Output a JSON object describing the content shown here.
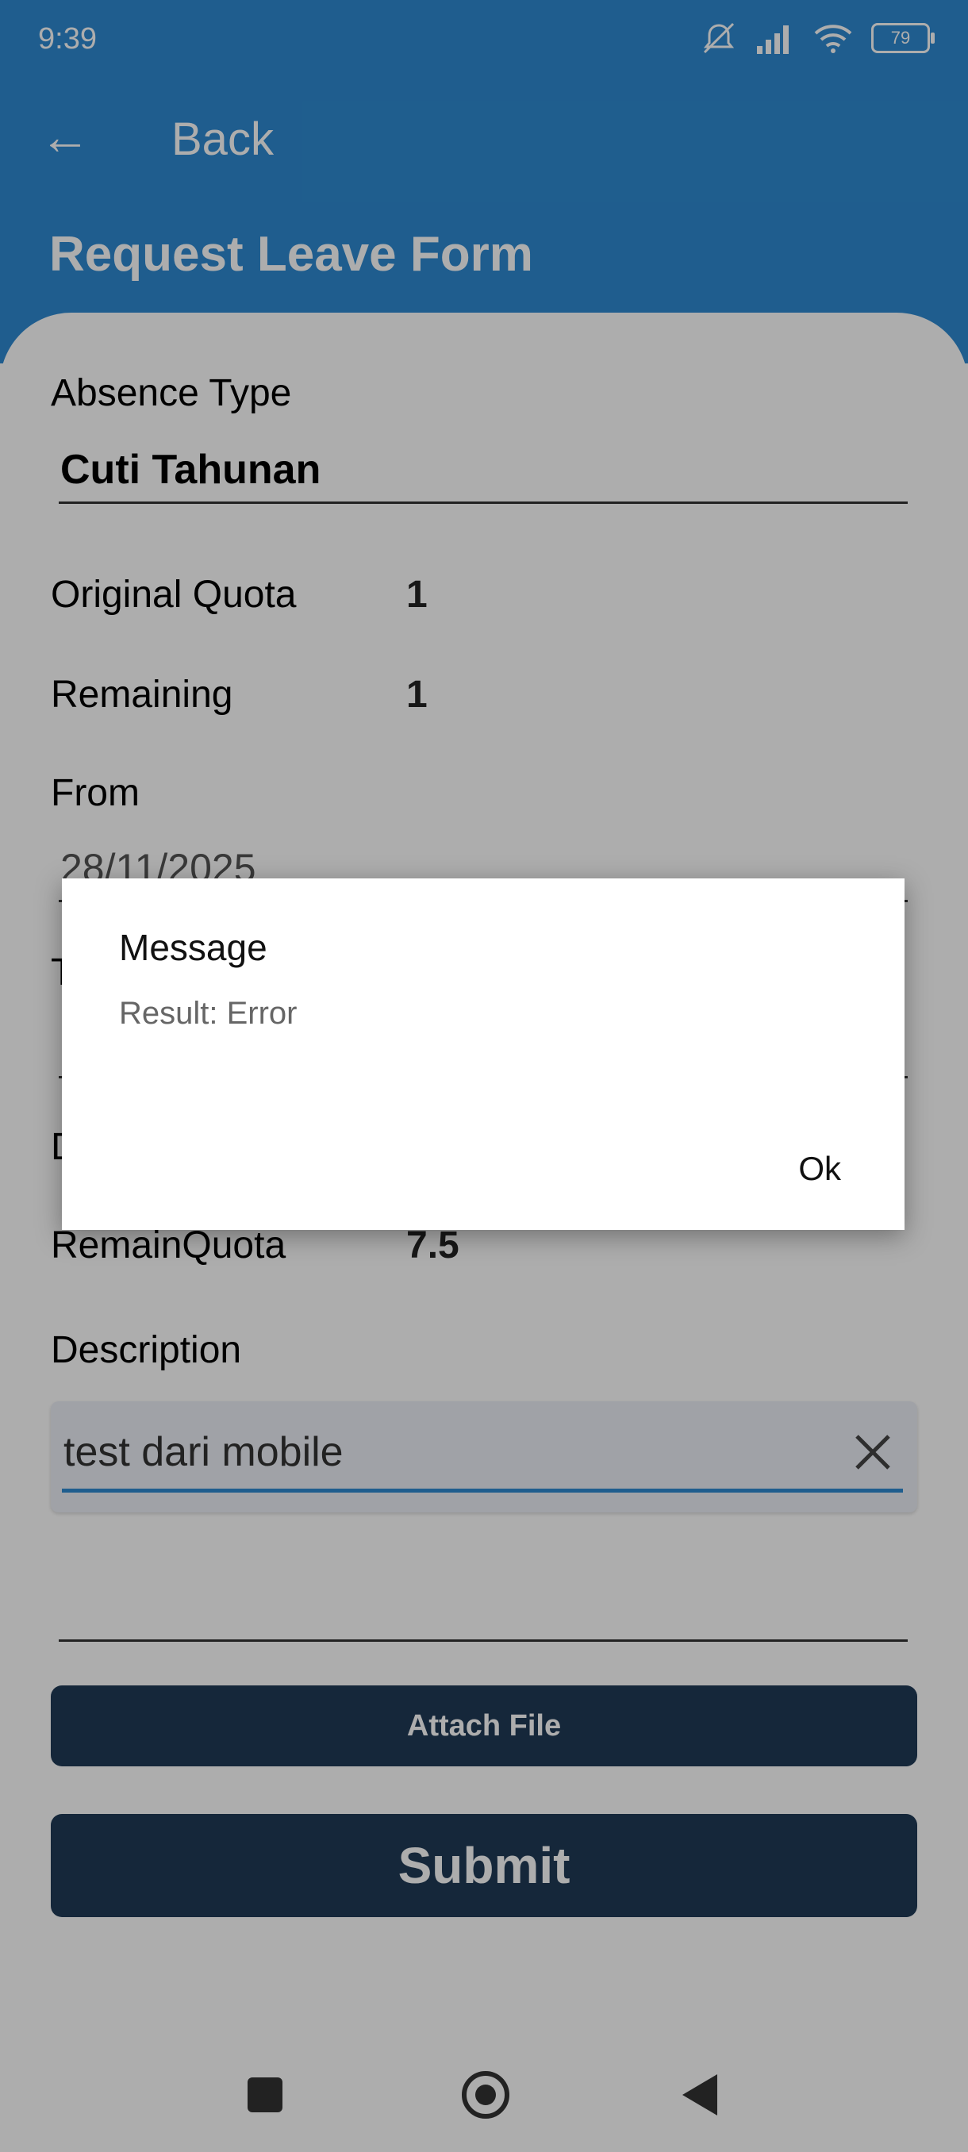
{
  "status_bar": {
    "time": "9:39",
    "battery": "79"
  },
  "app_bar": {
    "back_label": "Back"
  },
  "form": {
    "title": "Request Leave Form",
    "absence_type_label": "Absence Type",
    "absence_type_value": "Cuti Tahunan",
    "original_quota_label": "Original Quota",
    "original_quota_value": "1",
    "remaining_label": "Remaining",
    "remaining_value": "1",
    "from_label": "From",
    "from_value": "28/11/2025",
    "to_label": "T",
    "duration_label": "D",
    "remain_quota_label": "RemainQuota",
    "remain_quota_value": "7.5",
    "description_label": "Description",
    "description_value": "test dari mobile",
    "attach_label": "Attach File",
    "submit_label": "Submit"
  },
  "dialog": {
    "title": "Message",
    "message": "Result: Error",
    "ok_label": "Ok"
  },
  "colors": {
    "primary": "#2e8ad1",
    "button": "#1f3a56"
  }
}
